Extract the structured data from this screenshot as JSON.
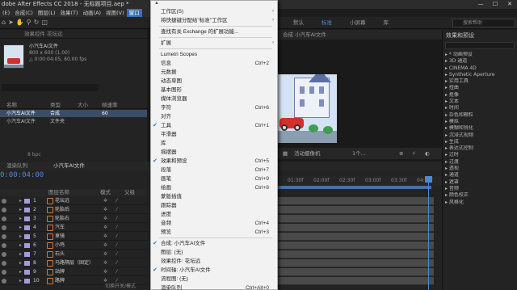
{
  "window": {
    "title": "dobe After Effects CC 2018 - 无标题项目.aep *",
    "controls": [
      "—",
      "☐",
      "✕"
    ]
  },
  "menubar": [
    {
      "label": "(E)",
      "selected": false
    },
    {
      "label": "合成(C)",
      "selected": false
    },
    {
      "label": "图层(L)",
      "selected": false
    },
    {
      "label": "效果(T)",
      "selected": false
    },
    {
      "label": "动画(A)",
      "selected": false
    },
    {
      "label": "视图(V)",
      "selected": false
    },
    {
      "label": "窗口",
      "selected": true
    }
  ],
  "workspaces": [
    {
      "label": "默认",
      "active": false
    },
    {
      "label": "标准",
      "active": true
    },
    {
      "label": "小屏幕",
      "active": false
    },
    {
      "label": "库",
      "active": false
    }
  ],
  "help_search": {
    "placeholder": "搜索帮助"
  },
  "project": {
    "header": "效果控件 花坛远",
    "comp_name": "小汽车AI文件",
    "comp_size": "800 x 600 (1.00)",
    "comp_duration": "△ 0:00:04:05, 60.00 fps",
    "columns": [
      "名称",
      "类型",
      "大小",
      "帧速率"
    ],
    "rows": [
      {
        "name": "小汽车AI文件",
        "type": "合成",
        "size": "",
        "fps": "60",
        "selected": true
      },
      {
        "name": "小汽车AI文件",
        "type": "文件夹",
        "size": "",
        "fps": "",
        "selected": false
      }
    ],
    "footer": "8 bpc"
  },
  "viewer": {
    "header": "合成 小汽车AI文件",
    "camera": "活动摄像机",
    "views": "1个..."
  },
  "timeline": {
    "tabs": [
      "渲染队列",
      "小汽车AI文件"
    ],
    "timecode": "0:00:04:00",
    "col_headers": [
      "图层名称",
      "模式",
      "父级"
    ],
    "layers": [
      {
        "num": "1",
        "name": "花坛远"
      },
      {
        "num": "2",
        "name": "轮胎后"
      },
      {
        "num": "3",
        "name": "轮胎右"
      },
      {
        "num": "4",
        "name": "汽车"
      },
      {
        "num": "5",
        "name": "車镜"
      },
      {
        "num": "6",
        "name": "小鸡"
      },
      {
        "num": "7",
        "name": "石头"
      },
      {
        "num": "8",
        "name": "马路隔层（固定）"
      },
      {
        "num": "9",
        "name": "站牌"
      },
      {
        "num": "10",
        "name": "路牌"
      }
    ],
    "ruler_ticks": [
      "01:30f",
      "02:00f",
      "02:30f",
      "03:00f",
      "03:30f",
      "04:00f"
    ],
    "footer": "切换开关/模式"
  },
  "effects_panel": {
    "title": "效果和预设",
    "items": [
      "* 动画预设",
      "3D 通道",
      "CINEMA 4D",
      "Synthetic Aperture",
      "实用工具",
      "扭曲",
      "抠像",
      "文本",
      "时间",
      "杂色和颗粒",
      "模拟",
      "模糊和锐化",
      "沉浸式视频",
      "生成",
      "表达式控制",
      "过时",
      "过渡",
      "透视",
      "通道",
      "遮罩",
      "音频",
      "颜色校正",
      "风格化"
    ]
  },
  "window_menu": {
    "items": [
      {
        "label": "工作区(S)",
        "shortcut": "",
        "checked": false,
        "submenu": true,
        "sep_after": false
      },
      {
        "label": "将快捷键分配给\"标准\"工作区",
        "shortcut": "",
        "checked": false,
        "submenu": true,
        "sep_after": true
      },
      {
        "label": "查找有关 Exchange 的扩展功能...",
        "shortcut": "",
        "checked": false,
        "submenu": false,
        "sep_after": true
      },
      {
        "label": "扩展",
        "shortcut": "",
        "checked": false,
        "submenu": true,
        "sep_after": true
      },
      {
        "label": "Lumetri Scopes",
        "shortcut": "",
        "checked": false,
        "submenu": false,
        "sep_after": false
      },
      {
        "label": "信息",
        "shortcut": "Ctrl+2",
        "checked": false,
        "submenu": false,
        "sep_after": false
      },
      {
        "label": "元数据",
        "shortcut": "",
        "checked": false,
        "submenu": false,
        "sep_after": false
      },
      {
        "label": "动态草图",
        "shortcut": "",
        "checked": false,
        "submenu": false,
        "sep_after": false
      },
      {
        "label": "基本图形",
        "shortcut": "",
        "checked": false,
        "submenu": false,
        "sep_after": false
      },
      {
        "label": "媒体浏览器",
        "shortcut": "",
        "checked": false,
        "submenu": false,
        "sep_after": false
      },
      {
        "label": "字符",
        "shortcut": "Ctrl+6",
        "checked": false,
        "submenu": false,
        "sep_after": false
      },
      {
        "label": "对齐",
        "shortcut": "",
        "checked": false,
        "submenu": false,
        "sep_after": false
      },
      {
        "label": "工具",
        "shortcut": "Ctrl+1",
        "checked": true,
        "submenu": false,
        "sep_after": false
      },
      {
        "label": "平滑器",
        "shortcut": "",
        "checked": false,
        "submenu": false,
        "sep_after": false
      },
      {
        "label": "库",
        "shortcut": "",
        "checked": false,
        "submenu": false,
        "sep_after": false
      },
      {
        "label": "摇摆器",
        "shortcut": "",
        "checked": false,
        "submenu": false,
        "sep_after": false
      },
      {
        "label": "效果和预设",
        "shortcut": "Ctrl+5",
        "checked": true,
        "submenu": false,
        "sep_after": false
      },
      {
        "label": "段落",
        "shortcut": "Ctrl+7",
        "checked": false,
        "submenu": false,
        "sep_after": false
      },
      {
        "label": "画笔",
        "shortcut": "Ctrl+9",
        "checked": false,
        "submenu": false,
        "sep_after": false
      },
      {
        "label": "绘画",
        "shortcut": "Ctrl+8",
        "checked": false,
        "submenu": false,
        "sep_after": false
      },
      {
        "label": "蒙版插值",
        "shortcut": "",
        "checked": false,
        "submenu": false,
        "sep_after": false
      },
      {
        "label": "跟踪器",
        "shortcut": "",
        "checked": false,
        "submenu": false,
        "sep_after": false
      },
      {
        "label": "进度",
        "shortcut": "",
        "checked": false,
        "submenu": false,
        "sep_after": false
      },
      {
        "label": "音频",
        "shortcut": "Ctrl+4",
        "checked": false,
        "submenu": false,
        "sep_after": false
      },
      {
        "label": "预览",
        "shortcut": "Ctrl+3",
        "checked": false,
        "submenu": false,
        "sep_after": true
      },
      {
        "label": "合成: 小汽车AI文件",
        "shortcut": "",
        "checked": true,
        "submenu": false,
        "sep_after": false
      },
      {
        "label": "图层: (无)",
        "shortcut": "",
        "checked": false,
        "submenu": false,
        "sep_after": false
      },
      {
        "label": "效果控件: 花坛远",
        "shortcut": "",
        "checked": false,
        "submenu": false,
        "sep_after": false
      },
      {
        "label": "时间轴: 小汽车AI文件",
        "shortcut": "",
        "checked": true,
        "submenu": false,
        "sep_after": false
      },
      {
        "label": "流程图: (无)",
        "shortcut": "",
        "checked": false,
        "submenu": false,
        "sep_after": false
      },
      {
        "label": "渲染队列",
        "shortcut": "Ctrl+Alt+0",
        "checked": false,
        "submenu": false,
        "sep_after": false
      }
    ]
  }
}
